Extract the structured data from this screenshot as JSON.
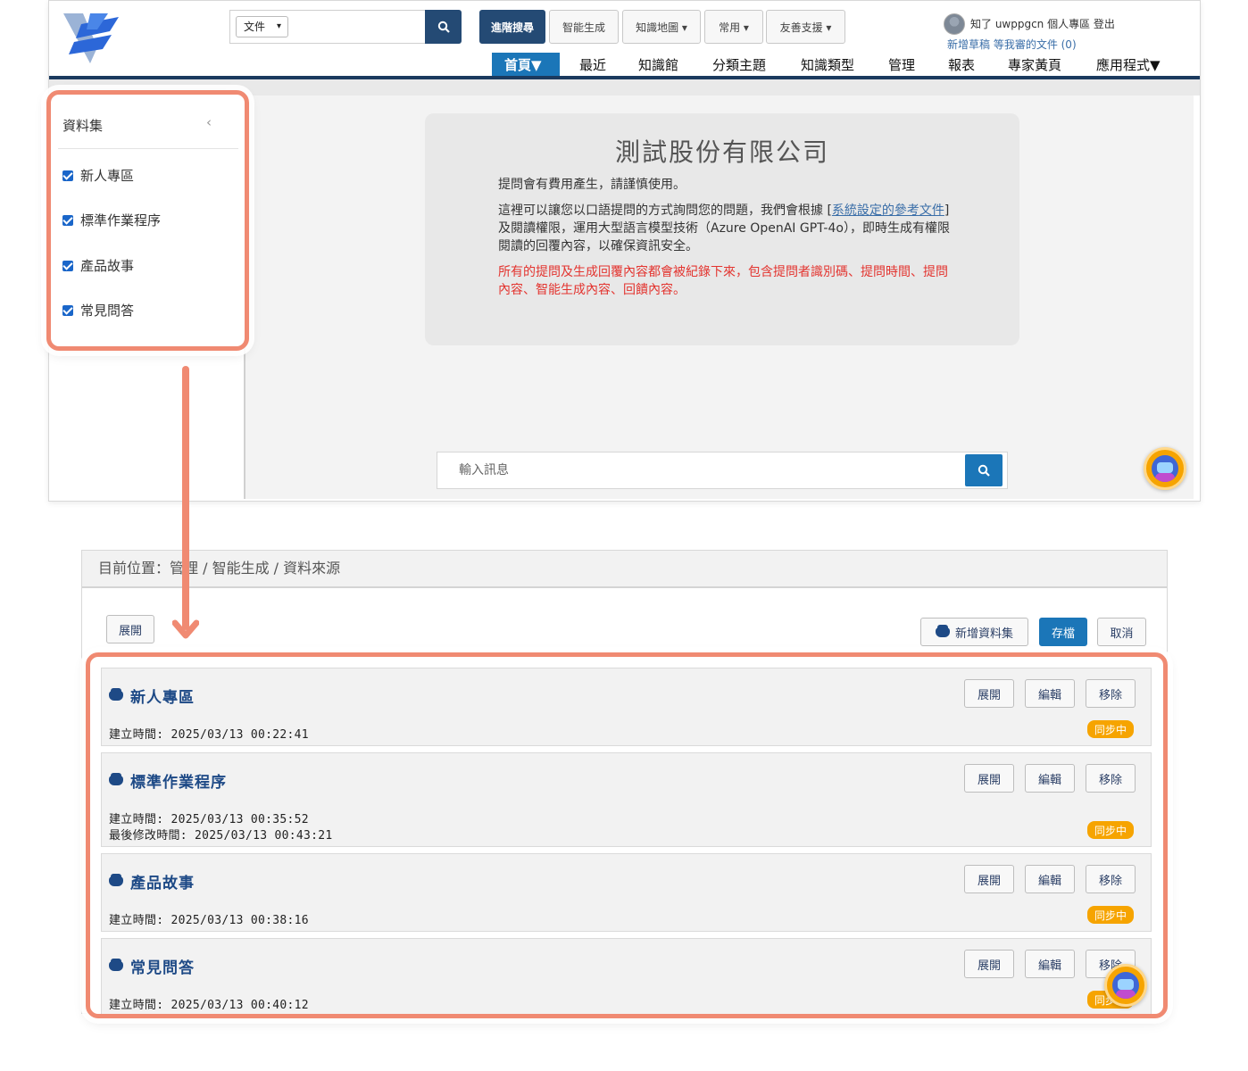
{
  "header": {
    "search_type": "文件",
    "buttons": [
      "進階搜尋",
      "智能生成",
      "知識地圖 ▾",
      "常用 ▾",
      "友善支援 ▾"
    ],
    "user_name_line": "知了  uwppgcn   個人專區   登出",
    "user_links": "新增草稿    等我審的文件 (0)"
  },
  "nav": {
    "items": [
      "首頁▼",
      "最近",
      "知識館",
      "分類主題",
      "知識類型",
      "管理",
      "報表",
      "專家黃頁",
      "應用程式▼"
    ]
  },
  "intro": {
    "title": "測試股份有限公司",
    "line1": "提問會有費用產生，請謹慎使用。",
    "line2_pre": "這裡可以讓您以口語提問的方式詢問您的問題，我們會根據 [",
    "line2_link": "系統設定的參考文件",
    "line2_post": "] 及閱讀權限，運用大型語言模型技術（Azure OpenAI GPT-4o），即時生成有權限閱讀的回覆內容，以確保資訊安全。",
    "warning": "所有的提問及生成回覆內容都會被紀錄下來，包含提問者識別碼、提問時間、提問內容、智能生成內容、回饋內容。"
  },
  "chat": {
    "placeholder": "輸入訊息"
  },
  "dataset_panel": {
    "title": "資料集",
    "collapse": "‹",
    "items": [
      "新人專區",
      "標準作業程序",
      "產品故事",
      "常見問答"
    ]
  },
  "admin": {
    "breadcrumb": "目前位置：管理 / 智能生成 / 資料來源",
    "expand_all": "展開",
    "add_dataset": "新增資料集",
    "save": "存檔",
    "cancel": "取消",
    "row_buttons": {
      "expand": "展開",
      "edit": "編輯",
      "remove": "移除"
    },
    "badge": "同步中",
    "datasets": [
      {
        "name": "新人專區",
        "created": "建立時間: 2025/03/13 00:22:41",
        "modified": ""
      },
      {
        "name": "標準作業程序",
        "created": "建立時間: 2025/03/13 00:35:52",
        "modified": "最後修改時間: 2025/03/13 00:43:21"
      },
      {
        "name": "產品故事",
        "created": "建立時間: 2025/03/13 00:38:16",
        "modified": ""
      },
      {
        "name": "常見問答",
        "created": "建立時間: 2025/03/13 00:40:12",
        "modified": ""
      }
    ]
  },
  "colors": {
    "accent": "#f08a72",
    "navy": "#244a74",
    "blue": "#1b76b8",
    "badge": "#f6a400"
  },
  "icons": [
    "logo",
    "search-icon",
    "bot-icon",
    "database-icon",
    "checkbox-checked-icon"
  ]
}
